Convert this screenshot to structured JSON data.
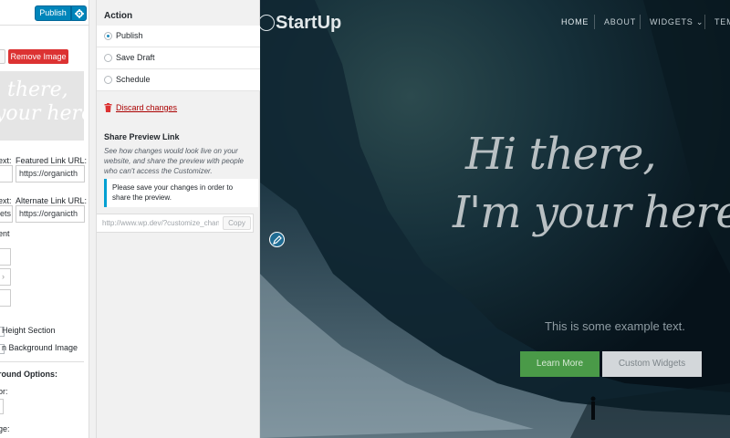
{
  "sidebar": {
    "publish_label": "Publish",
    "remove_image_label": "Remove Image",
    "thumbnail_line1": "i there,",
    "thumbnail_line2": "your here.",
    "featured_text_label": "ext:",
    "featured_url_label": "Featured Link URL:",
    "featured_url_value": "https://organicth",
    "alternate_text_label": "ext:",
    "alternate_text_value": "ets",
    "alternate_url_label": "Alternate Link URL:",
    "alternate_url_value": "https://organicth",
    "alignment_label": "ent",
    "option_full_height": "Height Section",
    "option_bg_image": "n Background Image",
    "bg_options_heading": "round Options:",
    "color_label": "or:",
    "image_label": "ge:"
  },
  "panel": {
    "action_title": "Action",
    "radios": [
      {
        "label": "Publish",
        "selected": true
      },
      {
        "label": "Save Draft",
        "selected": false
      },
      {
        "label": "Schedule",
        "selected": false
      }
    ],
    "discard_label": "Discard changes",
    "share_title": "Share Preview Link",
    "share_description": "See how changes would look live on your website, and share the preview with people who can't access the Customizer.",
    "notice_text": "Please save your changes in order to share the preview.",
    "preview_url": "http://www.wp.dev/?customize_changeset_uuid=",
    "copy_label": "Copy"
  },
  "site": {
    "logo": "StartUp",
    "nav": [
      {
        "label": "HOME",
        "active": true
      },
      {
        "label": "ABOUT",
        "active": false
      },
      {
        "label": "WIDGETS ⌄",
        "active": false
      },
      {
        "label": "TEM",
        "active": false
      }
    ],
    "headline_line1": "Hi there,",
    "headline_line2": "I'm your here.",
    "subtext": "This is some example text.",
    "learn_more_label": "Learn More",
    "custom_widgets_label": "Custom Widgets"
  },
  "colors": {
    "wp_blue": "#0085ba",
    "danger_red": "#dc3232",
    "accent_green": "#4a9a48",
    "notice_blue": "#00a0d2"
  }
}
